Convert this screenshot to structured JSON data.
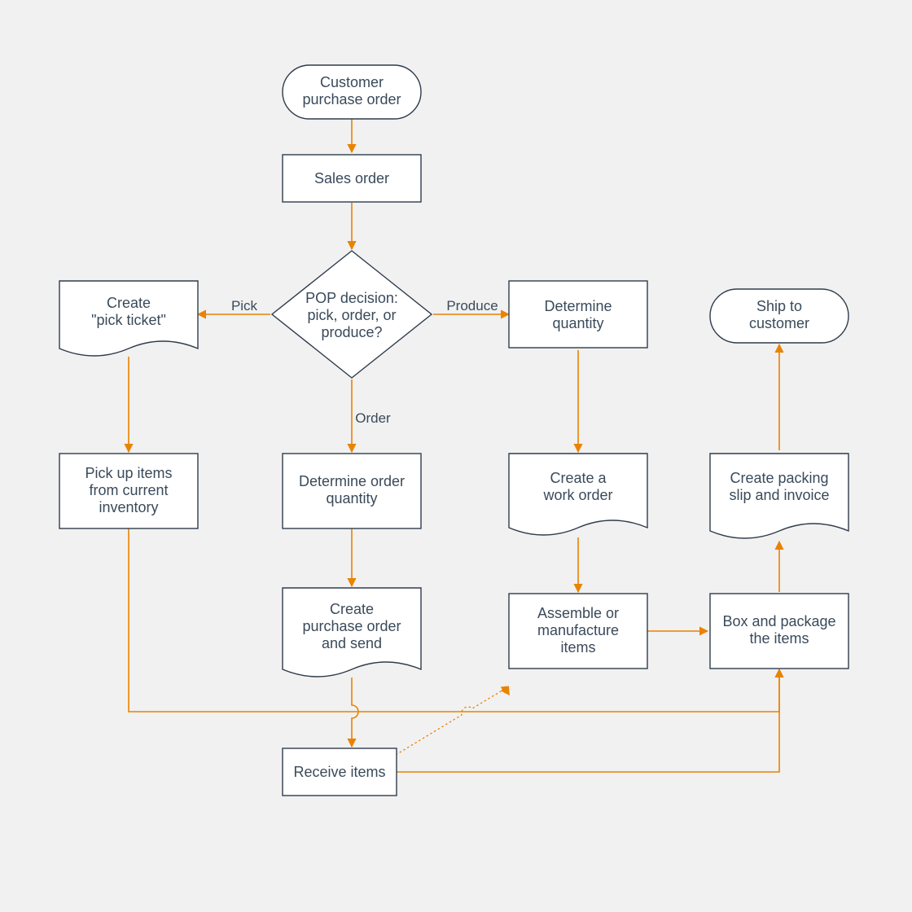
{
  "diagram": {
    "nodes": {
      "start": {
        "type": "terminator",
        "lines": [
          "Customer",
          "purchase order"
        ]
      },
      "salesOrder": {
        "type": "process",
        "lines": [
          "Sales order"
        ]
      },
      "popDecision": {
        "type": "decision",
        "lines": [
          "POP decision:",
          "pick, order, or",
          "produce?"
        ]
      },
      "pickTicket": {
        "type": "document",
        "lines": [
          "Create",
          "\"pick ticket\""
        ]
      },
      "determineQty": {
        "type": "process",
        "lines": [
          "Determine",
          "quantity"
        ]
      },
      "shipEnd": {
        "type": "terminator",
        "lines": [
          "Ship to",
          "customer"
        ]
      },
      "pickupItems": {
        "type": "process",
        "lines": [
          "Pick up items",
          "from current",
          "inventory"
        ]
      },
      "determineOrderQty": {
        "type": "process",
        "lines": [
          "Determine order",
          "quantity"
        ]
      },
      "workOrder": {
        "type": "document",
        "lines": [
          "Create a",
          "work order"
        ]
      },
      "packingSlip": {
        "type": "document",
        "lines": [
          "Create packing",
          "slip and invoice"
        ]
      },
      "createPO": {
        "type": "document",
        "lines": [
          "Create",
          "purchase order",
          "and send"
        ]
      },
      "assemble": {
        "type": "process",
        "lines": [
          "Assemble or",
          "manufacture",
          "items"
        ]
      },
      "boxPackage": {
        "type": "process",
        "lines": [
          "Box and package",
          "the items"
        ]
      },
      "receiveItems": {
        "type": "process",
        "lines": [
          "Receive items"
        ]
      }
    },
    "edges": {
      "pick": "Pick",
      "produce": "Produce",
      "order": "Order"
    },
    "colors": {
      "arrow": "#e98300",
      "stroke": "#2f3c4c",
      "text": "#3a4a5a",
      "background": "#f1f1f1"
    }
  }
}
